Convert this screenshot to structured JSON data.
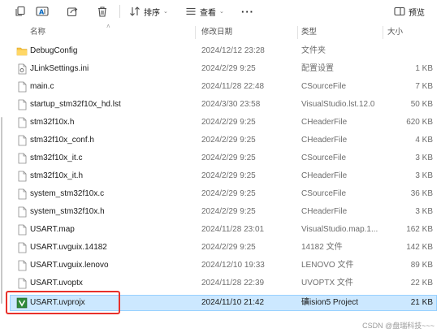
{
  "toolbar": {
    "sort_label": "排序",
    "view_label": "查看",
    "more_label": "···",
    "preview_label": "预览"
  },
  "columns": {
    "name": "名称",
    "date": "修改日期",
    "type": "类型",
    "size": "大小"
  },
  "files": [
    {
      "name": "DebugConfig",
      "date": "2024/12/12 23:28",
      "type": "文件夹",
      "size": "",
      "icon": "folder-icon"
    },
    {
      "name": "JLinkSettings.ini",
      "date": "2024/2/29 9:25",
      "type": "配置设置",
      "size": "1 KB",
      "icon": "ini-file-icon"
    },
    {
      "name": "main.c",
      "date": "2024/11/28 22:48",
      "type": "CSourceFile",
      "size": "7 KB",
      "icon": "file-icon"
    },
    {
      "name": "startup_stm32f10x_hd.lst",
      "date": "2024/3/30 23:58",
      "type": "VisualStudio.lst.12.0",
      "size": "50 KB",
      "icon": "file-icon"
    },
    {
      "name": "stm32f10x.h",
      "date": "2024/2/29 9:25",
      "type": "CHeaderFile",
      "size": "620 KB",
      "icon": "file-icon"
    },
    {
      "name": "stm32f10x_conf.h",
      "date": "2024/2/29 9:25",
      "type": "CHeaderFile",
      "size": "4 KB",
      "icon": "file-icon"
    },
    {
      "name": "stm32f10x_it.c",
      "date": "2024/2/29 9:25",
      "type": "CSourceFile",
      "size": "3 KB",
      "icon": "file-icon"
    },
    {
      "name": "stm32f10x_it.h",
      "date": "2024/2/29 9:25",
      "type": "CHeaderFile",
      "size": "3 KB",
      "icon": "file-icon"
    },
    {
      "name": "system_stm32f10x.c",
      "date": "2024/2/29 9:25",
      "type": "CSourceFile",
      "size": "36 KB",
      "icon": "file-icon"
    },
    {
      "name": "system_stm32f10x.h",
      "date": "2024/2/29 9:25",
      "type": "CHeaderFile",
      "size": "3 KB",
      "icon": "file-icon"
    },
    {
      "name": "USART.map",
      "date": "2024/11/28 23:01",
      "type": "VisualStudio.map.1...",
      "size": "162 KB",
      "icon": "file-icon"
    },
    {
      "name": "USART.uvguix.14182",
      "date": "2024/2/29 9:25",
      "type": "14182 文件",
      "size": "142 KB",
      "icon": "file-icon"
    },
    {
      "name": "USART.uvguix.lenovo",
      "date": "2024/12/10 19:33",
      "type": "LENOVO 文件",
      "size": "89 KB",
      "icon": "file-icon"
    },
    {
      "name": "USART.uvoptx",
      "date": "2024/11/28 22:39",
      "type": "UVOPTX 文件",
      "size": "22 KB",
      "icon": "file-icon"
    },
    {
      "name": "USART.uvprojx",
      "date": "2024/11/10 21:42",
      "type": "礦ision5 Project",
      "size": "21 KB",
      "icon": "uvision-project-icon",
      "selected": true
    }
  ],
  "watermark": "CSDN @盘瑞科技~~~",
  "colors": {
    "selection": "#cce8ff",
    "selection_border": "#99d1ff",
    "highlight_box": "#e8312b",
    "folder": "#f6c244",
    "uvision": "#2f8a3a",
    "accent": "#0067c0"
  }
}
